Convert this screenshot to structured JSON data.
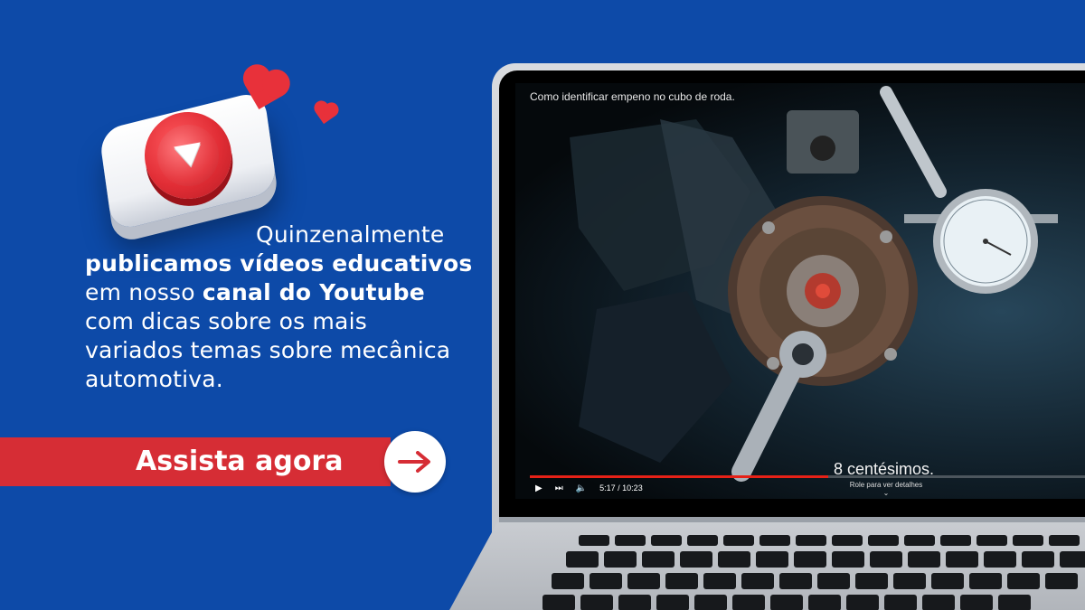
{
  "colors": {
    "background": "#0d4aa8",
    "accent_red": "#d62d35",
    "white": "#ffffff"
  },
  "decor": {
    "icon": "play-button-3d-icon",
    "hearts": [
      "heart-icon",
      "heart-icon"
    ]
  },
  "copy": {
    "line1": "Quinzenalmente",
    "line2_bold": "publicamos vídeos educativos",
    "line3_plain": "em nosso ",
    "line3_bold": "canal do Youtube",
    "line4": "com dicas sobre os mais",
    "line5": "variados temas sobre mecânica",
    "line6": "automotiva."
  },
  "cta": {
    "label": "Assista agora",
    "icon": "arrow-right-icon"
  },
  "video": {
    "title": "Como identificar empeno no cubo de roda.",
    "subtitle": "8 centésimos.",
    "time": "5:17 / 10:23",
    "progress": 0.515,
    "scroll_hint": "Role para ver detalhes"
  }
}
